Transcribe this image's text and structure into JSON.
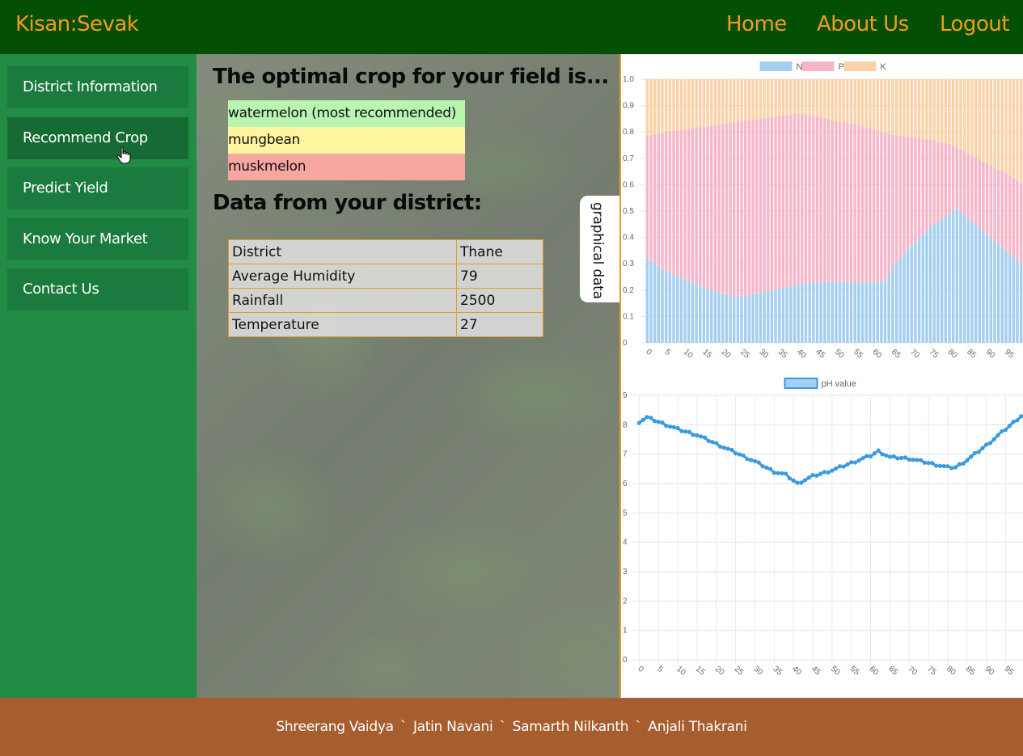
{
  "header": {
    "brand": "Kisan:Sevak",
    "nav": [
      "Home",
      "About Us",
      "Logout"
    ]
  },
  "sidebar": {
    "items": [
      "District Information",
      "Recommend Crop",
      "Predict Yield",
      "Know Your Market",
      "Contact Us"
    ],
    "active_index": 1
  },
  "main": {
    "title": "The optimal crop for your field is...",
    "crops": [
      "watermelon (most recommended)",
      "mungbean",
      "muskmelon"
    ],
    "district_heading": "Data from your district:",
    "district_table": [
      [
        "District",
        "Thane"
      ],
      [
        "Average Humidity",
        "79"
      ],
      [
        "Rainfall",
        "2500"
      ],
      [
        "Temperature",
        "27"
      ]
    ]
  },
  "tab": {
    "label": "graphical data"
  },
  "chart_data": [
    {
      "type": "bar",
      "stacked": true,
      "legend_position": "top",
      "series": [
        {
          "name": "N",
          "color": "#a4cff0",
          "anchors": [
            [
              0,
              0.32
            ],
            [
              5,
              0.27
            ],
            [
              10,
              0.24
            ],
            [
              15,
              0.21
            ],
            [
              20,
              0.185
            ],
            [
              25,
              0.175
            ],
            [
              30,
              0.19
            ],
            [
              35,
              0.205
            ],
            [
              40,
              0.22
            ],
            [
              45,
              0.23
            ],
            [
              50,
              0.23
            ],
            [
              55,
              0.23
            ],
            [
              60,
              0.23
            ],
            [
              63,
              0.235
            ],
            [
              65,
              0.29
            ],
            [
              70,
              0.37
            ],
            [
              75,
              0.44
            ],
            [
              80,
              0.49
            ],
            [
              82,
              0.51
            ],
            [
              85,
              0.47
            ],
            [
              90,
              0.41
            ],
            [
              95,
              0.35
            ],
            [
              99,
              0.3
            ]
          ]
        },
        {
          "name": "P",
          "color": "#f7b6c8",
          "anchors": [
            [
              0,
              0.785
            ],
            [
              5,
              0.8
            ],
            [
              10,
              0.81
            ],
            [
              15,
              0.82
            ],
            [
              20,
              0.83
            ],
            [
              25,
              0.84
            ],
            [
              30,
              0.85
            ],
            [
              35,
              0.86
            ],
            [
              40,
              0.87
            ],
            [
              45,
              0.86
            ],
            [
              50,
              0.84
            ],
            [
              55,
              0.83
            ],
            [
              60,
              0.81
            ],
            [
              65,
              0.79
            ],
            [
              70,
              0.78
            ],
            [
              75,
              0.77
            ],
            [
              80,
              0.755
            ],
            [
              85,
              0.72
            ],
            [
              90,
              0.68
            ],
            [
              95,
              0.645
            ],
            [
              99,
              0.605
            ]
          ]
        },
        {
          "name": "K",
          "color": "#fbd2a8",
          "anchors": [
            [
              0,
              1.0
            ],
            [
              99,
              1.0
            ]
          ]
        }
      ],
      "x_ticks": [
        "0",
        "5",
        "10",
        "15",
        "20",
        "25",
        "30",
        "35",
        "40",
        "45",
        "50",
        "55",
        "60",
        "65",
        "70",
        "75",
        "80",
        "85",
        "90",
        "95"
      ],
      "y_ticks": [
        "0",
        "0.1",
        "0.2",
        "0.3",
        "0.4",
        "0.5",
        "0.6",
        "0.7",
        "0.8",
        "0.9",
        "1.0"
      ],
      "ylim": [
        0,
        1.0
      ]
    },
    {
      "type": "line",
      "legend_position": "top",
      "series": [
        {
          "name": "pH value",
          "color": "#3a9be0",
          "anchors": [
            [
              0,
              8.1
            ],
            [
              2,
              8.25
            ],
            [
              4,
              8.15
            ],
            [
              6,
              8.05
            ],
            [
              10,
              7.85
            ],
            [
              15,
              7.65
            ],
            [
              20,
              7.35
            ],
            [
              25,
              7.05
            ],
            [
              30,
              6.75
            ],
            [
              35,
              6.4
            ],
            [
              38,
              6.3
            ],
            [
              40,
              6.1
            ],
            [
              41,
              6.0
            ],
            [
              45,
              6.25
            ],
            [
              50,
              6.45
            ],
            [
              55,
              6.7
            ],
            [
              60,
              6.95
            ],
            [
              62,
              7.1
            ],
            [
              65,
              6.9
            ],
            [
              70,
              6.85
            ],
            [
              75,
              6.7
            ],
            [
              80,
              6.55
            ],
            [
              82,
              6.55
            ],
            [
              85,
              6.8
            ],
            [
              90,
              7.3
            ],
            [
              95,
              7.85
            ],
            [
              99,
              8.3
            ]
          ]
        }
      ],
      "x_ticks": [
        "0",
        "5",
        "10",
        "15",
        "20",
        "25",
        "30",
        "35",
        "40",
        "45",
        "50",
        "55",
        "60",
        "65",
        "70",
        "75",
        "80",
        "85",
        "90",
        "95"
      ],
      "y_ticks": [
        "0",
        "1",
        "2",
        "3",
        "4",
        "5",
        "6",
        "7",
        "8",
        "9"
      ],
      "ylim": [
        0,
        9
      ]
    }
  ],
  "footer": {
    "credits": [
      "Shreerang Vaidya",
      "Jatin Navani",
      "Samarth Nilkanth",
      "Anjali Thakrani"
    ],
    "separator": "`"
  }
}
